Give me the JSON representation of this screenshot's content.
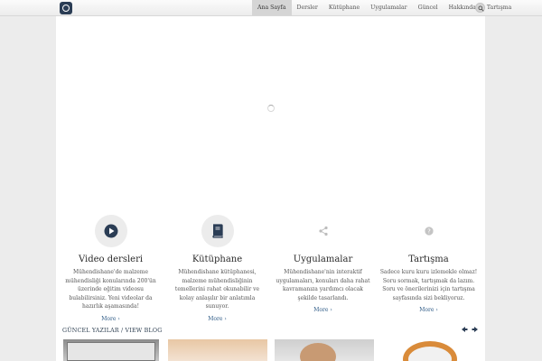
{
  "nav": {
    "items": [
      {
        "label": "Ana Sayfa",
        "active": true
      },
      {
        "label": "Dersler",
        "active": false
      },
      {
        "label": "Kütüphane",
        "active": false
      },
      {
        "label": "Uygulamalar",
        "active": false
      },
      {
        "label": "Güncel",
        "active": false
      },
      {
        "label": "Hakkında",
        "active": false
      },
      {
        "label": "Tartışma",
        "active": false
      }
    ]
  },
  "features": [
    {
      "icon": "play-icon",
      "title": "Video dersleri",
      "desc": "Mühendishane'de malzeme mühendisliği konularında 200'ün üzerinde eğitim videosu bulabilirsiniz. Yeni videolar da hazırlık aşamasında!",
      "more": "More ›"
    },
    {
      "icon": "book-icon",
      "title": "Kütüphane",
      "desc": "Mühendishane kütüphanesi, malzeme mühendisliğinin temellerini rahat okunabilir ve kolay anlaşılır bir anlatımla sunuyor.",
      "more": "More ›"
    },
    {
      "icon": "share-icon",
      "title": "Uygulamalar",
      "desc": "Mühendishane'nin interaktif uygulamaları, konuları daha rahat kavramanıza yardımcı olacak şekilde tasarlandı.",
      "more": "More ›"
    },
    {
      "icon": "question-icon",
      "title": "Tartışma",
      "desc": "Sadece kuru kuru izlemekle olmaz! Soru sormak, tartışmak da lazım. Soru ve önerilerinizi için tartışma sayfasında sizi bekliyoruz.",
      "more": "More ›"
    }
  ],
  "news": {
    "heading": "GÜNCEL YAZILAR",
    "separator": " / ",
    "link": "VIEW BLOG"
  },
  "colors": {
    "accent": "#2d5a86",
    "icon_dark": "#2b3d55",
    "background": "#ececec"
  }
}
